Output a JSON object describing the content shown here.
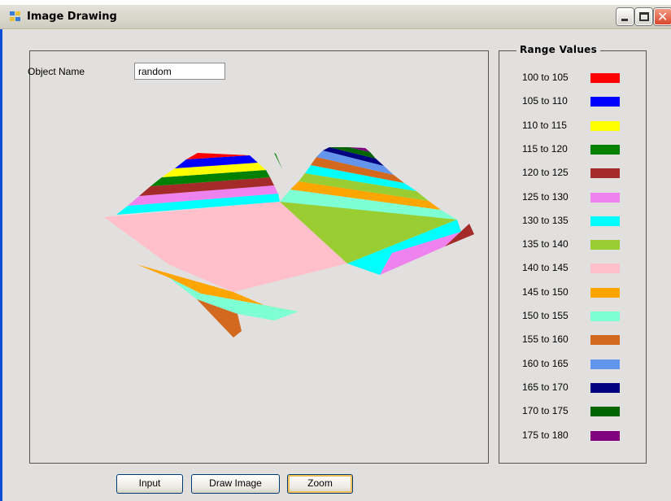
{
  "window": {
    "title": "Image Drawing"
  },
  "form": {
    "object_name_label": "Object Name",
    "object_name_value": "random"
  },
  "range_values": {
    "title": "Range Values",
    "items": [
      {
        "label": "100 to 105",
        "color": "#ff0000"
      },
      {
        "label": "105 to 110",
        "color": "#0000ff"
      },
      {
        "label": "110 to 115",
        "color": "#ffff00"
      },
      {
        "label": "115 to 120",
        "color": "#008000"
      },
      {
        "label": "120 to 125",
        "color": "#a52a2a"
      },
      {
        "label": "125 to 130",
        "color": "#ee82ee"
      },
      {
        "label": "130 to 135",
        "color": "#00ffff"
      },
      {
        "label": "135 to 140",
        "color": "#9acd32"
      },
      {
        "label": "140 to 145",
        "color": "#ffc0cb"
      },
      {
        "label": "145 to 150",
        "color": "#ffa500"
      },
      {
        "label": "150 to 155",
        "color": "#7fffd4"
      },
      {
        "label": "155 to 160",
        "color": "#d2691e"
      },
      {
        "label": "160 to 165",
        "color": "#6495ed"
      },
      {
        "label": "165 to 170",
        "color": "#000080"
      },
      {
        "label": "170 to 175",
        "color": "#006400"
      },
      {
        "label": "175 to 180",
        "color": "#800080"
      }
    ]
  },
  "buttons": {
    "input": "Input",
    "draw_image": "Draw Image",
    "zoom": "Zoom"
  },
  "icons": {
    "app": "app-window-icon",
    "minimize": "minimize-icon",
    "maximize": "maximize-icon",
    "close": "close-icon"
  }
}
